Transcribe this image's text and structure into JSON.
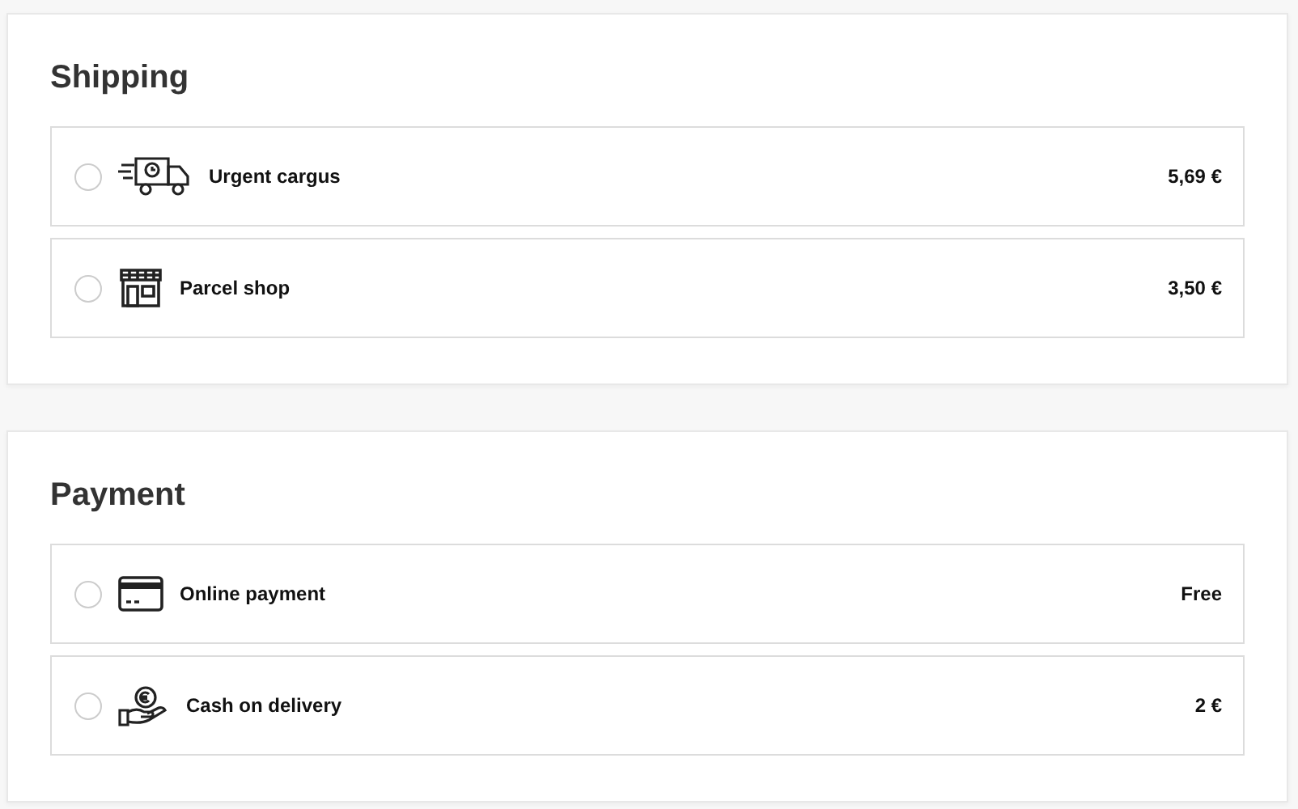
{
  "sections": [
    {
      "title": "Shipping",
      "options": [
        {
          "kind": "truck",
          "label": "Urgent cargus",
          "price": "5,69 €",
          "selected": false
        },
        {
          "kind": "shop",
          "label": "Parcel shop",
          "price": "3,50 €",
          "selected": false
        }
      ]
    },
    {
      "title": "Payment",
      "options": [
        {
          "kind": "card",
          "label": "Online payment",
          "price": "Free",
          "selected": false
        },
        {
          "kind": "cash",
          "label": "Cash on delivery",
          "price": "2 €",
          "selected": false
        }
      ]
    }
  ]
}
